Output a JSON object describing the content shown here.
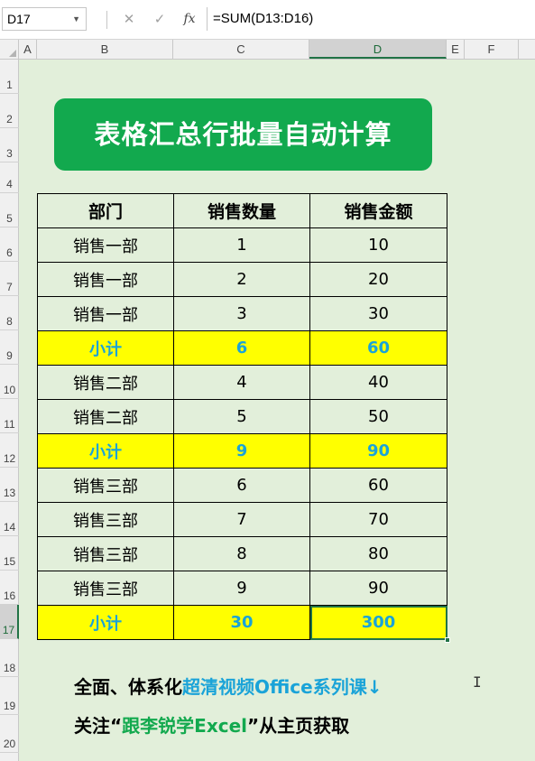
{
  "formula_bar": {
    "name_box": "D17",
    "cancel_icon": "✕",
    "enter_icon": "✓",
    "fx_label": "fx",
    "formula": "=SUM(D13:D16)"
  },
  "columns": [
    "A",
    "B",
    "C",
    "D",
    "E",
    "F"
  ],
  "selected_column": "D",
  "rows": [
    "1",
    "2",
    "3",
    "4",
    "5",
    "6",
    "7",
    "8",
    "9",
    "10",
    "11",
    "12",
    "13",
    "14",
    "15",
    "16",
    "17",
    "18",
    "19",
    "20"
  ],
  "selected_row": "17",
  "banner": {
    "title": "表格汇总行批量自动计算"
  },
  "table": {
    "headers": [
      "部门",
      "销售数量",
      "销售金额"
    ],
    "rows": [
      {
        "dept": "销售一部",
        "qty": "1",
        "amount": "10",
        "subtotal": false
      },
      {
        "dept": "销售一部",
        "qty": "2",
        "amount": "20",
        "subtotal": false
      },
      {
        "dept": "销售一部",
        "qty": "3",
        "amount": "30",
        "subtotal": false
      },
      {
        "dept": "小计",
        "qty": "6",
        "amount": "60",
        "subtotal": true
      },
      {
        "dept": "销售二部",
        "qty": "4",
        "amount": "40",
        "subtotal": false
      },
      {
        "dept": "销售二部",
        "qty": "5",
        "amount": "50",
        "subtotal": false
      },
      {
        "dept": "小计",
        "qty": "9",
        "amount": "90",
        "subtotal": true
      },
      {
        "dept": "销售三部",
        "qty": "6",
        "amount": "60",
        "subtotal": false
      },
      {
        "dept": "销售三部",
        "qty": "7",
        "amount": "70",
        "subtotal": false
      },
      {
        "dept": "销售三部",
        "qty": "8",
        "amount": "80",
        "subtotal": false
      },
      {
        "dept": "销售三部",
        "qty": "9",
        "amount": "90",
        "subtotal": false
      },
      {
        "dept": "小计",
        "qty": "30",
        "amount": "300",
        "subtotal": true
      }
    ]
  },
  "footer": {
    "line1_black": "全面、体系化",
    "line1_blue": "超清视频Office系列课↓",
    "line2_black_a": "关注“",
    "line2_green": "跟李锐学Excel",
    "line2_black_b": "”从主页获取"
  },
  "colors": {
    "sheet_bg": "#e2efda",
    "banner_bg": "#12a94e",
    "subtotal_bg": "#ffff00",
    "subtotal_text": "#1aa3d8",
    "selection": "#217346"
  }
}
